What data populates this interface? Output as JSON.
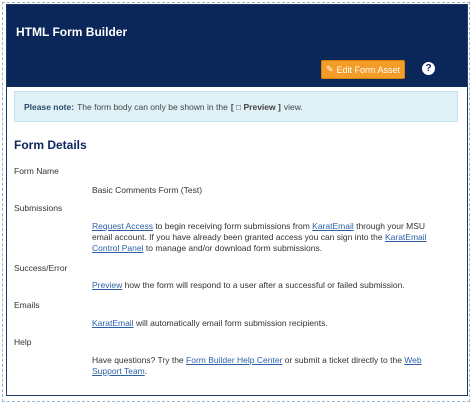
{
  "header": {
    "title": "HTML Form Builder",
    "edit_button": "Edit Form Asset",
    "help_icon": "?"
  },
  "note": {
    "label": "Please note:",
    "text_before": "The form body can only be shown in the",
    "preview_label": "[ □ Preview ]",
    "text_after": "view."
  },
  "section": {
    "title": "Form Details"
  },
  "fields": {
    "form_name": {
      "label": "Form Name",
      "value": "Basic Comments Form (Test)"
    },
    "submissions": {
      "label": "Submissions",
      "link1": "Request Access",
      "t1": " to begin receiving form submissions from ",
      "link2": "KaratEmail",
      "t2": " through your MSU email account. If you have already been granted access you can sign into the ",
      "link3": "KaratEmail Control Panel",
      "t3": " to manage and/or download form submissions."
    },
    "success": {
      "label": "Success/Error",
      "link": "Preview",
      "text": " how the form will respond to a user after a successful or failed submission."
    },
    "emails": {
      "label": "Emails",
      "link": "KaratEmail",
      "text": " will automatically email form submission recipients."
    },
    "help": {
      "label": "Help",
      "t1": "Have questions? Try the ",
      "link1": "Form Builder Help Center",
      "t2": " or submit a ticket directly to the ",
      "link2": "Web Support Team",
      "t3": "."
    }
  }
}
